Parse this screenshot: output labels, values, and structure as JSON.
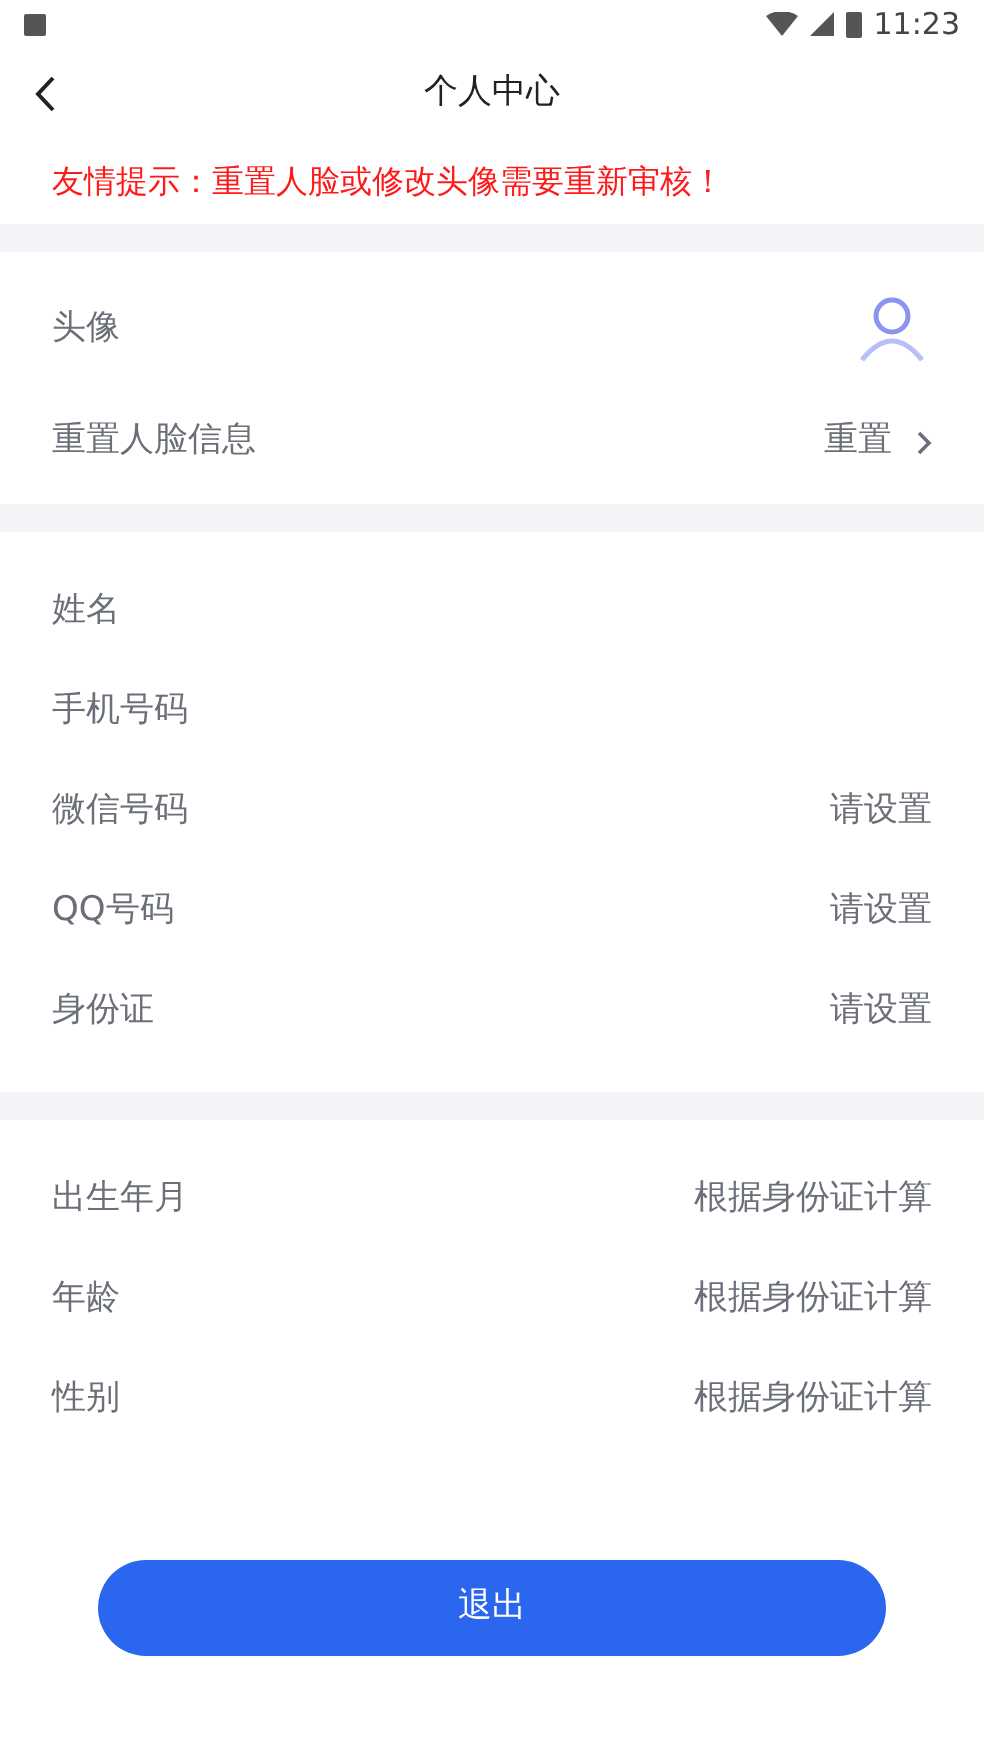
{
  "status_bar": {
    "time": "11:23"
  },
  "header": {
    "title": "个人中心"
  },
  "notice": "友情提示：重置人脸或修改头像需要重新审核！",
  "sections": [
    {
      "rows": [
        {
          "kind": "avatar",
          "label": "头像"
        },
        {
          "kind": "link",
          "label": "重置人脸信息",
          "value": "重置"
        }
      ]
    },
    {
      "rows": [
        {
          "kind": "text",
          "label": "姓名"
        },
        {
          "kind": "text",
          "label": "手机号码"
        },
        {
          "kind": "text",
          "label": "微信号码",
          "value": "请设置"
        },
        {
          "kind": "text",
          "label": "QQ号码",
          "value": "请设置"
        },
        {
          "kind": "text",
          "label": "身份证",
          "value": "请设置"
        }
      ]
    },
    {
      "rows": [
        {
          "kind": "text",
          "label": "出生年月",
          "value": "根据身份证计算"
        },
        {
          "kind": "text",
          "label": "年龄",
          "value": "根据身份证计算"
        },
        {
          "kind": "text",
          "label": "性别",
          "value": "根据身份证计算"
        }
      ]
    }
  ],
  "logout_button": "退出"
}
